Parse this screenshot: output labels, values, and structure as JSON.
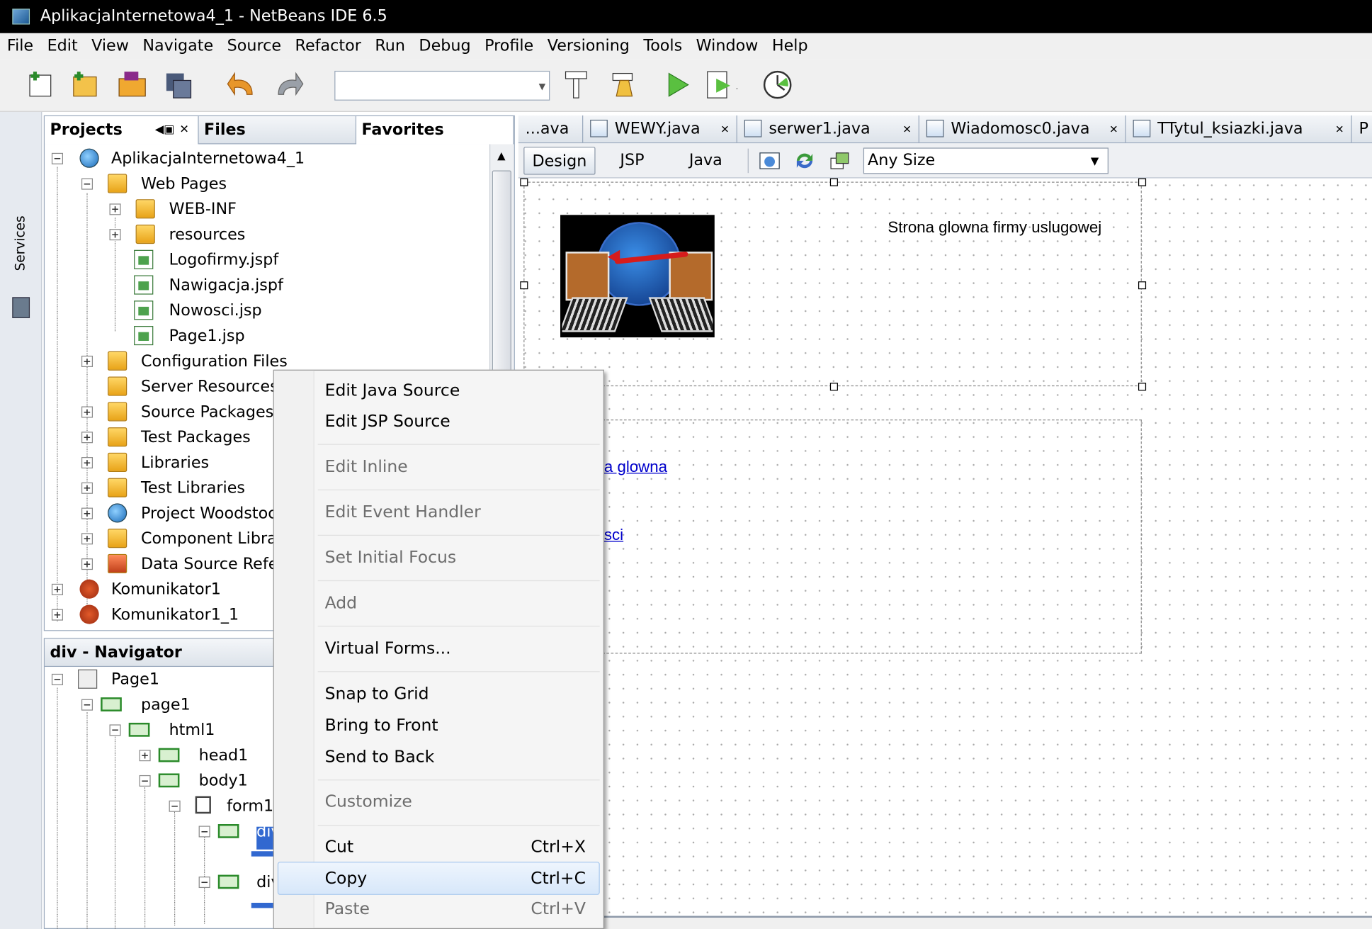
{
  "window": {
    "title": "AplikacjaInternetowa4_1 - NetBeans IDE 6.5"
  },
  "menubar": {
    "items": [
      "File",
      "Edit",
      "View",
      "Navigate",
      "Source",
      "Refactor",
      "Run",
      "Debug",
      "Profile",
      "Versioning",
      "Tools",
      "Window",
      "Help"
    ]
  },
  "toolbar": {
    "icons": [
      "new-project-icon",
      "new-file-icon",
      "open-project-icon",
      "save-all-icon",
      "undo-icon",
      "redo-icon",
      "build-icon",
      "clean-build-icon",
      "run-icon",
      "debug-icon",
      "profile-icon"
    ],
    "config_value": ""
  },
  "services_strip": {
    "label": "Services"
  },
  "projects_panel": {
    "tabs": {
      "projects": "Projects",
      "files": "Files",
      "favorites": "Favorites"
    },
    "tree": [
      {
        "label": "AplikacjaInternetowa4_1",
        "expander": "−"
      },
      {
        "label": "Web Pages",
        "expander": "−"
      },
      {
        "label": "WEB-INF",
        "expander": "+"
      },
      {
        "label": "resources",
        "expander": "+"
      },
      {
        "label": "Logofirmy.jspf"
      },
      {
        "label": "Nawigacja.jspf"
      },
      {
        "label": "Nowosci.jsp"
      },
      {
        "label": "Page1.jsp"
      },
      {
        "label": "Configuration Files",
        "expander": "+"
      },
      {
        "label": "Server Resources"
      },
      {
        "label": "Source Packages",
        "expander": "+"
      },
      {
        "label": "Test Packages",
        "expander": "+"
      },
      {
        "label": "Libraries",
        "expander": "+"
      },
      {
        "label": "Test Libraries",
        "expander": "+"
      },
      {
        "label": "Project Woodstock",
        "expander": "+"
      },
      {
        "label": "Component Libraries",
        "expander": "+"
      },
      {
        "label": "Data Source References",
        "expander": "+"
      },
      {
        "label": "Komunikator1",
        "expander": "+"
      },
      {
        "label": "Komunikator1_1",
        "expander": "+"
      }
    ]
  },
  "navigator": {
    "title": "div - Navigator",
    "tree": [
      {
        "label": "Page1",
        "expander": "−"
      },
      {
        "label": "page1",
        "expander": "−"
      },
      {
        "label": "html1",
        "expander": "−"
      },
      {
        "label": "head1",
        "expander": "+"
      },
      {
        "label": "body1",
        "expander": "−"
      },
      {
        "label": "form1",
        "expander": "−"
      },
      {
        "label": "div",
        "expander": "−"
      },
      {
        "label": "div",
        "expander": "−"
      }
    ]
  },
  "editor": {
    "tabs": [
      "...ava",
      "WEWY.java",
      "serwer1.java",
      "Wiadomosc0.java",
      "TTytul_ksiazki.java",
      "P"
    ],
    "views": {
      "design": "Design",
      "jsp": "JSP",
      "java": "Java"
    },
    "size_value": "Any Size"
  },
  "canvas": {
    "headline": "Strona glowna firmy uslugowej",
    "link1": "a glowna",
    "link2": "sci"
  },
  "context_menu": {
    "items": [
      {
        "label": "Edit Java Source",
        "enabled": true
      },
      {
        "label": "Edit JSP Source",
        "enabled": true
      },
      {
        "label": "Edit Inline",
        "enabled": false
      },
      {
        "label": "Edit Event Handler",
        "enabled": false
      },
      {
        "label": "Set Initial Focus",
        "enabled": false
      },
      {
        "label": "Add",
        "enabled": false
      },
      {
        "label": "Virtual Forms...",
        "enabled": true
      },
      {
        "label": "Snap to Grid",
        "enabled": true
      },
      {
        "label": "Bring to Front",
        "enabled": true
      },
      {
        "label": "Send to Back",
        "enabled": true
      },
      {
        "label": "Customize",
        "enabled": false
      },
      {
        "label": "Cut",
        "shortcut": "Ctrl+X",
        "enabled": true
      },
      {
        "label": "Copy",
        "shortcut": "Ctrl+C",
        "enabled": true,
        "highlighted": true
      },
      {
        "label": "Paste",
        "shortcut": "Ctrl+V",
        "enabled": false
      }
    ]
  }
}
